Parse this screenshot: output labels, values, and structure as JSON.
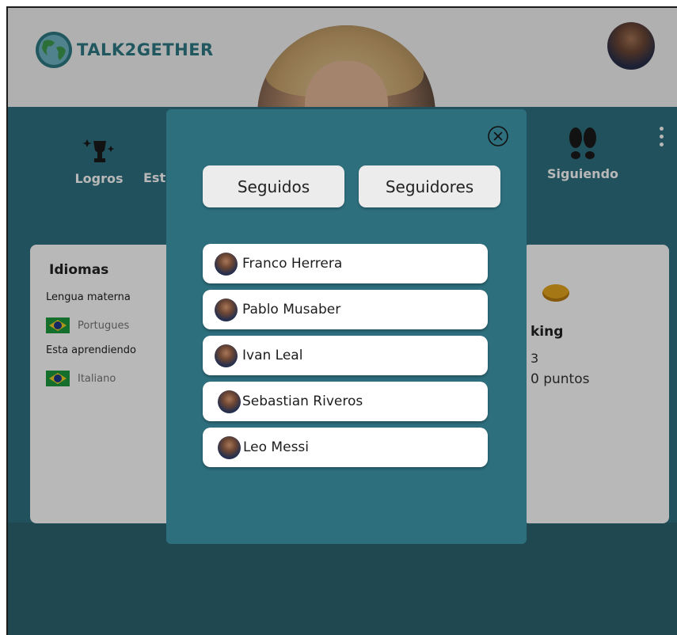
{
  "app": {
    "logo_text": "TALK2GETHER"
  },
  "nav": {
    "logros_label": "Logros",
    "est_label": "Est",
    "siguiendo_label": "Siguiendo"
  },
  "languages_card": {
    "title": "Idiomas",
    "native_label": "Lengua materna",
    "native_language": "Portugues",
    "learning_label": "Esta aprendiendo",
    "learning_language": "Italiano"
  },
  "ranking_card": {
    "title_partial": "king",
    "number_partial": "3",
    "points_partial": "0 puntos"
  },
  "modal": {
    "tabs": [
      {
        "label": "Seguidos"
      },
      {
        "label": "Seguidores"
      }
    ],
    "follows": [
      {
        "name": "Franco Herrera"
      },
      {
        "name": "Pablo Musaber"
      },
      {
        "name": "Ivan Leal"
      },
      {
        "name": "Sebastian Riveros"
      },
      {
        "name": "Leo Messi"
      }
    ]
  },
  "colors": {
    "header_bg": "#f4f4f4",
    "main_bg": "#2f7180",
    "modal_bg": "#2e6f7e",
    "brand_text": "#2f7a86",
    "coin": "#e5a51e"
  }
}
